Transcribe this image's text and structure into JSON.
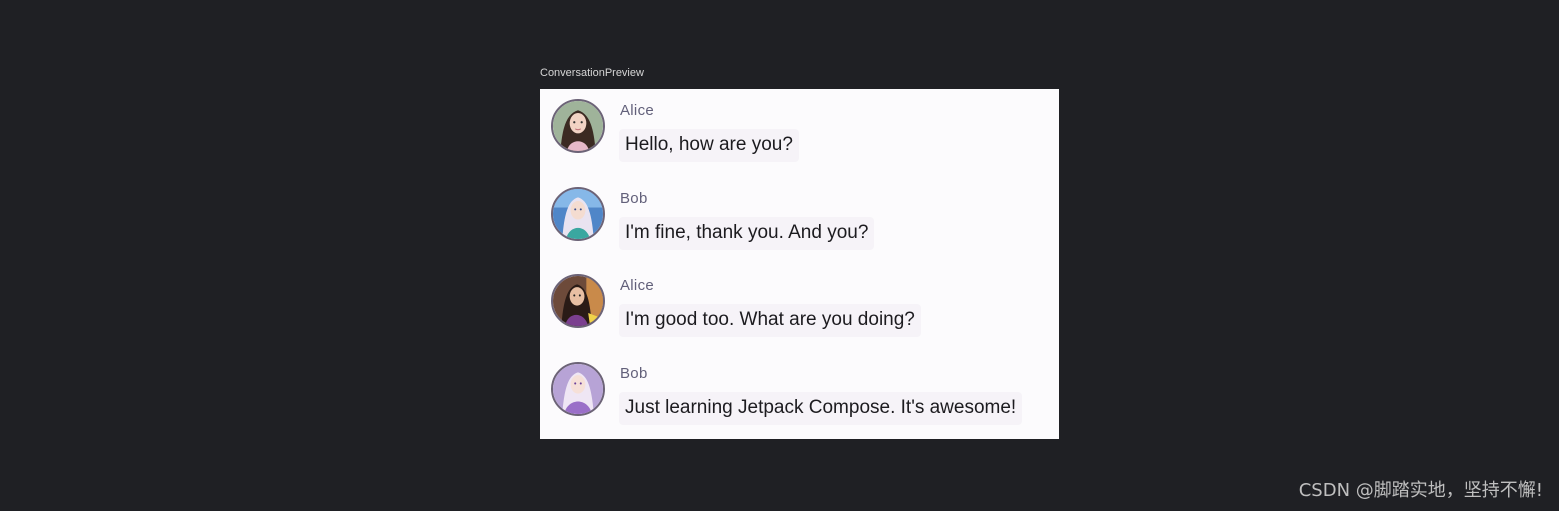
{
  "preview": {
    "label": "ConversationPreview"
  },
  "messages": [
    {
      "author": "Alice",
      "body": "Hello, how are you?",
      "avatar_icon": "avatar-girl-green-hair-icon"
    },
    {
      "author": "Bob",
      "body": "I'm fine, thank you. And you?",
      "avatar_icon": "avatar-girl-blue-dress-icon"
    },
    {
      "author": "Alice",
      "body": "I'm good too. What are you doing?",
      "avatar_icon": "avatar-girl-dark-hair-icon"
    },
    {
      "author": "Bob",
      "body": "Just learning Jetpack Compose. It's awesome!",
      "avatar_icon": "avatar-girl-purple-dress-icon"
    }
  ],
  "watermark": {
    "text": "CSDN @脚踏实地，坚持不懈!"
  },
  "colors": {
    "background": "#1f2024",
    "frame": "#fcfbfd",
    "avatar_border": "#6c6377",
    "author_text": "#62607a",
    "bubble_bg": "#f6f3f8",
    "body_text": "#1c1b1f"
  }
}
